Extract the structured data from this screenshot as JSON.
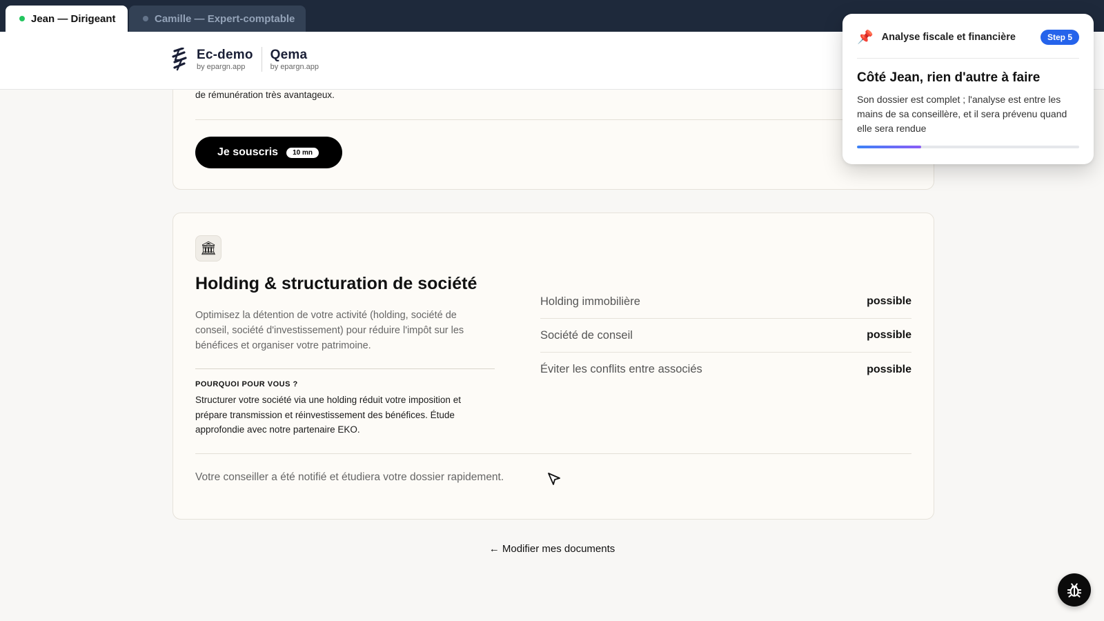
{
  "tabs": [
    {
      "label": "Jean — Dirigeant",
      "active": true,
      "status_color": "#22c55e"
    },
    {
      "label": "Camille — Expert-comptable",
      "active": false,
      "status_color": "#64748b"
    }
  ],
  "header": {
    "brand_primary": {
      "name": "Ec-demo",
      "sub": "by epargn.app"
    },
    "brand_secondary": {
      "name": "Qema",
      "sub": "by epargn.app"
    }
  },
  "top_card": {
    "clipped_text": "de rémunération très avantageux.",
    "subscribe_label": "Je souscris",
    "subscribe_duration": "10 mn"
  },
  "holding_card": {
    "icon": "bank-icon",
    "title": "Holding & structuration de société",
    "description": "Optimisez la détention de votre activité (holding, société de conseil, société d'investissement) pour réduire l'impôt sur les bénéfices et organiser votre patrimoine.",
    "why_label": "POURQUOI POUR VOUS ?",
    "why_text": "Structurer votre société via une holding réduit votre imposition et prépare transmission et réinvestissement des bénéfices. Étude approfondie avec notre partenaire EKO.",
    "features": [
      {
        "name": "Holding immobilière",
        "value": "possible"
      },
      {
        "name": "Société de conseil",
        "value": "possible"
      },
      {
        "name": "Éviter les conflits entre associés",
        "value": "possible"
      }
    ],
    "notified_text": "Votre conseiller a été notifié et étudiera votre dossier rapidement."
  },
  "modify_link": "← Modifier mes documents",
  "popover": {
    "icon": "pushpin-icon",
    "category": "Analyse fiscale et financière",
    "step": "Step 5",
    "title": "Côté Jean, rien d'autre à faire",
    "body": "Son dossier est complet ; l'analyse est entre les mains de sa conseillère, et il sera prévenu quand elle sera rendue",
    "progress": 0.29,
    "accent": "#2563eb"
  },
  "bug_button": {
    "icon": "bug-icon"
  }
}
